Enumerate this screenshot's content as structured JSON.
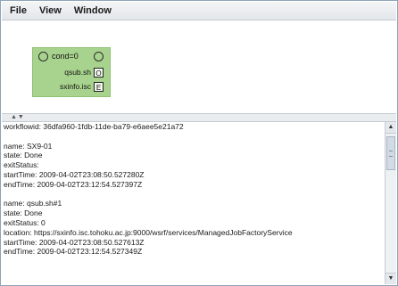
{
  "menubar": {
    "items": [
      "File",
      "View",
      "Window"
    ]
  },
  "workflow_node": {
    "condition": "cond=0",
    "tasks": [
      {
        "name": "qsub.sh",
        "badge": "O"
      },
      {
        "name": "sxinfo.isc",
        "badge": "E"
      }
    ]
  },
  "splitter": {
    "arrows": "▲▼"
  },
  "log": {
    "lines": [
      "workflowid: 36dfa960-1fdb-11de-ba79-e6aee5e21a72",
      "",
      "name: SX9-01",
      "state: Done",
      "exitStatus:",
      "startTime: 2009-04-02T23:08:50.527280Z",
      "endTime: 2009-04-02T23:12:54.527397Z",
      "",
      "name: qsub.sh#1",
      "state: Done",
      "exitStatus: 0",
      "location: https://sxinfo.isc.tohoku.ac.jp:9000/wsrf/services/ManagedJobFactoryService",
      "startTime: 2009-04-02T23:08:50.527613Z",
      "endTime: 2009-04-02T23:12:54.527349Z"
    ]
  },
  "scrollbar": {
    "up_icon": "▲",
    "down_icon": "▼"
  }
}
